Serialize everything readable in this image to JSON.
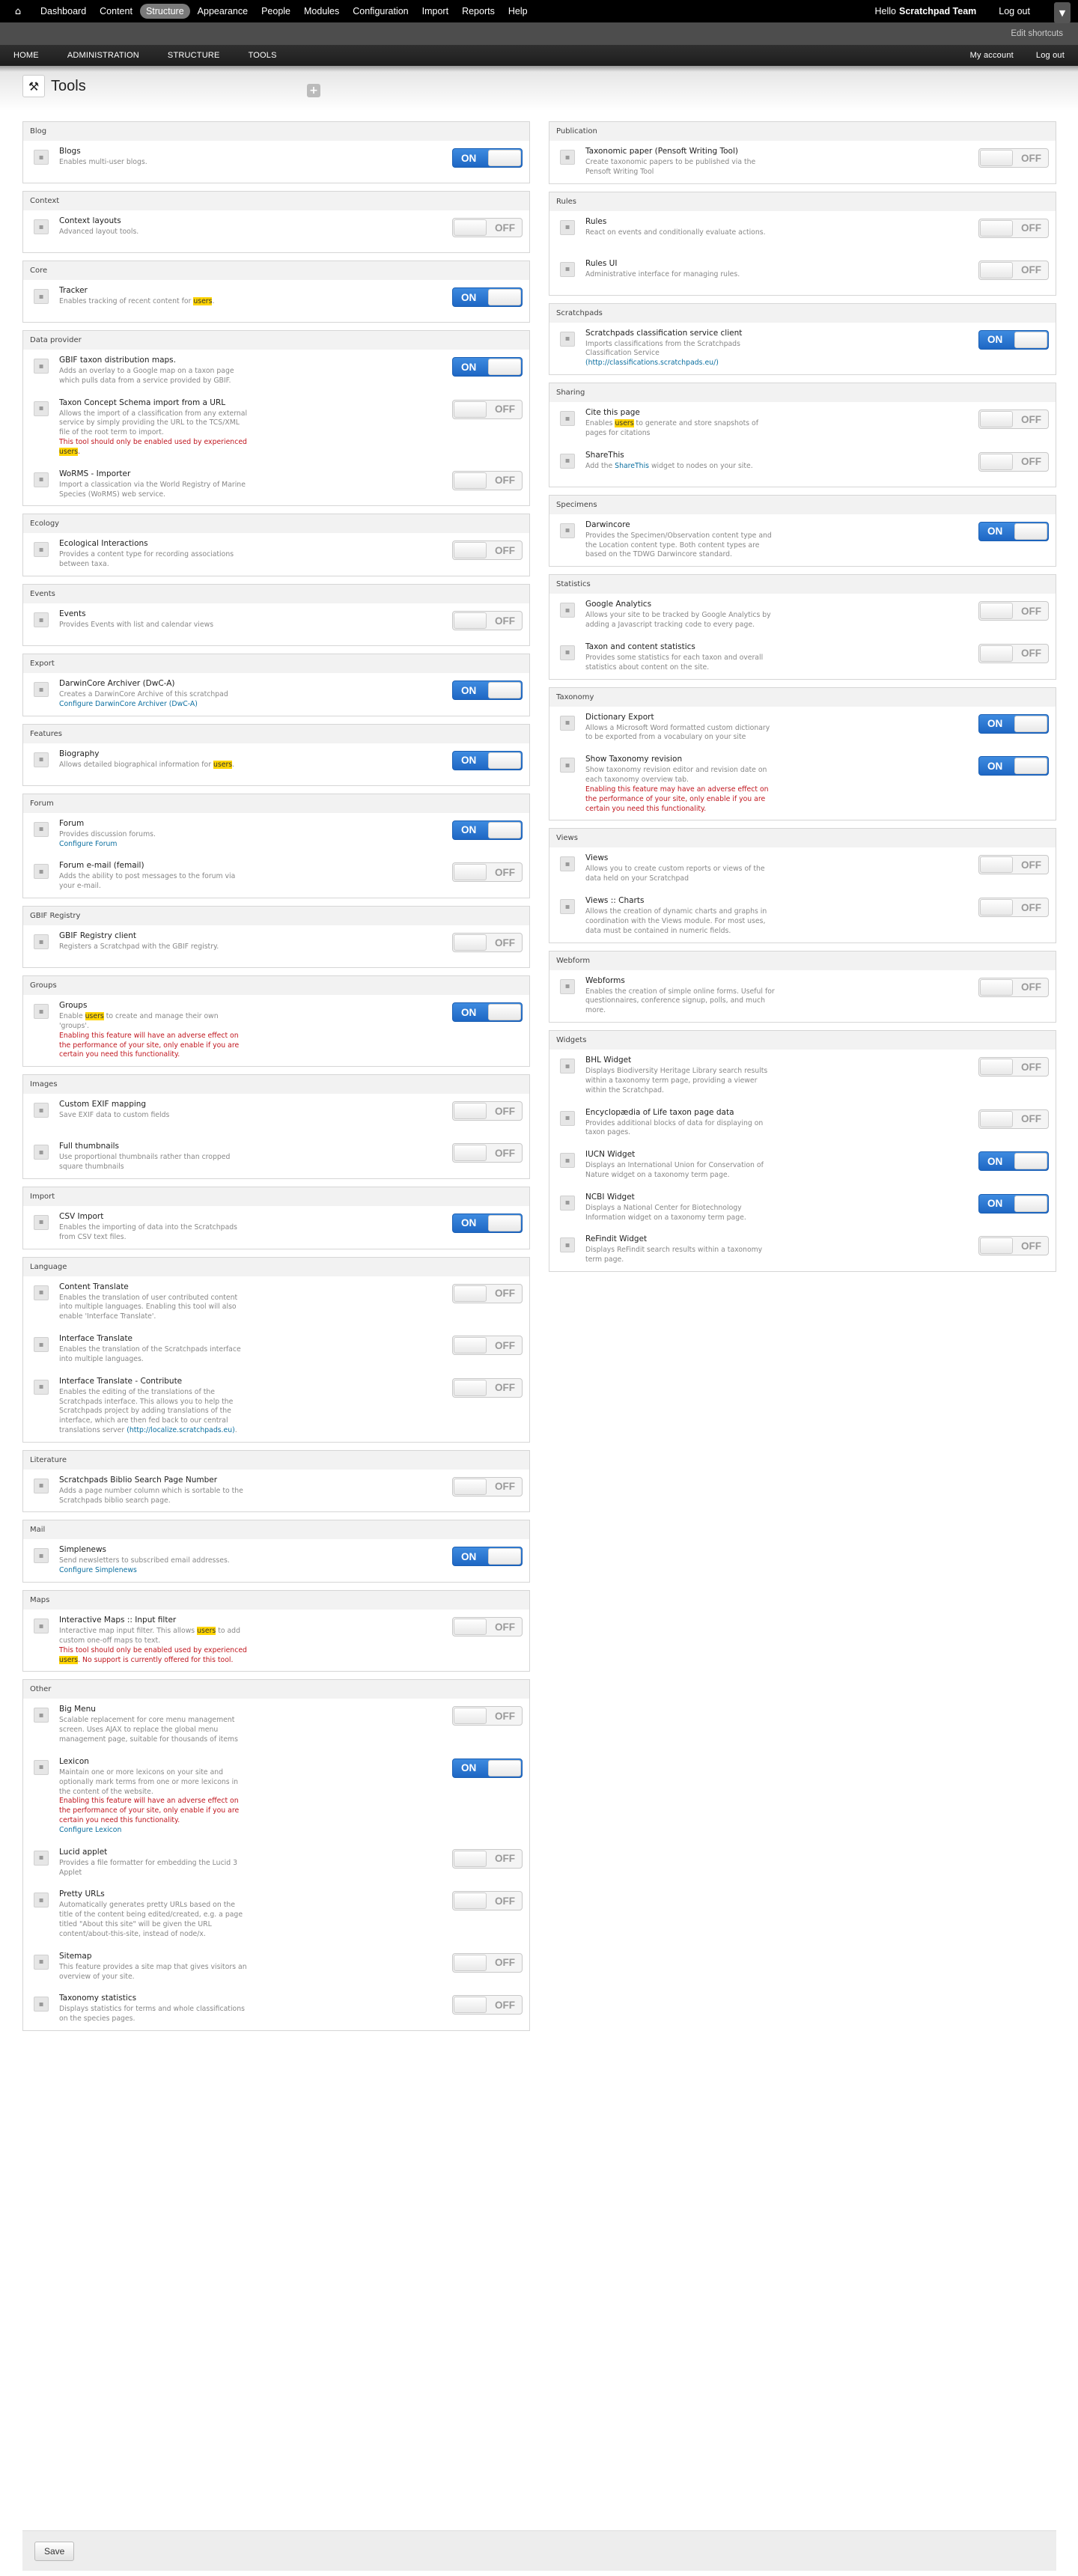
{
  "toolbar": {
    "menu": [
      "Dashboard",
      "Content",
      "Structure",
      "Appearance",
      "People",
      "Modules",
      "Configuration",
      "Import",
      "Reports",
      "Help"
    ],
    "active": "Structure",
    "hello": "Hello",
    "user": "Scratchpad Team",
    "logout": "Log out",
    "edit_shortcuts": "Edit shortcuts"
  },
  "nav": {
    "left": [
      "HOME",
      "ADMINISTRATION",
      "STRUCTURE",
      "TOOLS"
    ],
    "right": [
      "My account",
      "Log out"
    ]
  },
  "page_title": "Tools",
  "save_label": "Save",
  "left_sections": [
    {
      "title": "Blog",
      "items": [
        {
          "name": "Blogs",
          "desc": [
            {
              "t": "Enables multi-user blogs."
            }
          ],
          "on": true
        }
      ]
    },
    {
      "title": "Context",
      "items": [
        {
          "name": "Context layouts",
          "desc": [
            {
              "t": "Advanced layout tools."
            }
          ],
          "on": false
        }
      ]
    },
    {
      "title": "Core",
      "items": [
        {
          "name": "Tracker",
          "desc": [
            {
              "t": "Enables tracking of recent content for "
            },
            {
              "t": "users",
              "s": "hl"
            },
            {
              "t": "."
            }
          ],
          "on": true
        }
      ]
    },
    {
      "title": "Data provider",
      "items": [
        {
          "name": "GBIF taxon distribution maps.",
          "desc": [
            {
              "t": "Adds an overlay to a Google map on a taxon page which pulls data from a service provided by GBIF."
            }
          ],
          "on": true
        },
        {
          "name": "Taxon Concept Schema import from a URL",
          "desc": [
            {
              "t": "Allows the import of a classification from any external service by simply providing the URL to the TCS/XML file of the root term to import."
            },
            {
              "br": 1
            },
            {
              "t": "This tool should only be enabled used by experienced ",
              "s": "warn"
            },
            {
              "t": "users",
              "s": "hl"
            },
            {
              "t": ".",
              "s": "warn"
            }
          ],
          "on": false
        },
        {
          "name": "WoRMS - Importer",
          "desc": [
            {
              "t": "Import a classication via the World Registry of Marine Species (WoRMS) web service."
            }
          ],
          "on": false
        }
      ]
    },
    {
      "title": "Ecology",
      "items": [
        {
          "name": "Ecological Interactions",
          "desc": [
            {
              "t": "Provides a content type for recording associations between taxa."
            }
          ],
          "on": false
        }
      ]
    },
    {
      "title": "Events",
      "items": [
        {
          "name": "Events",
          "desc": [
            {
              "t": "Provides Events with list and calendar views"
            }
          ],
          "on": false
        }
      ]
    },
    {
      "title": "Export",
      "items": [
        {
          "name": "DarwinCore Archiver (DwC-A)",
          "desc": [
            {
              "t": "Creates a DarwinCore Archive of this scratchpad"
            },
            {
              "br": 1
            },
            {
              "t": "Configure DarwinCore Archiver (DwC-A)",
              "s": "ln"
            }
          ],
          "on": true
        }
      ]
    },
    {
      "title": "Features",
      "items": [
        {
          "name": "Biography",
          "desc": [
            {
              "t": "Allows detailed biographical information for "
            },
            {
              "t": "users",
              "s": "hl"
            },
            {
              "t": "."
            }
          ],
          "on": true
        }
      ]
    },
    {
      "title": "Forum",
      "items": [
        {
          "name": "Forum",
          "desc": [
            {
              "t": "Provides discussion forums."
            },
            {
              "br": 1
            },
            {
              "t": "Configure Forum",
              "s": "ln"
            }
          ],
          "on": true
        },
        {
          "name": "Forum e-mail (femail)",
          "desc": [
            {
              "t": "Adds the ability to post messages to the forum via your e-mail."
            }
          ],
          "on": false
        }
      ]
    },
    {
      "title": "GBIF Registry",
      "items": [
        {
          "name": "GBIF Registry client",
          "desc": [
            {
              "t": "Registers a Scratchpad with the GBIF registry."
            }
          ],
          "on": false
        }
      ]
    },
    {
      "title": "Groups",
      "items": [
        {
          "name": "Groups",
          "desc": [
            {
              "t": "Enable "
            },
            {
              "t": "users",
              "s": "hl"
            },
            {
              "t": " to create and manage their own 'groups'."
            },
            {
              "br": 1
            },
            {
              "t": "Enabling this feature will have an adverse effect on the performance of your site, only enable if you are certain you need this functionality.",
              "s": "warn"
            }
          ],
          "on": true
        }
      ]
    },
    {
      "title": "Images",
      "items": [
        {
          "name": "Custom EXIF mapping",
          "desc": [
            {
              "t": "Save EXIF data to custom fields"
            }
          ],
          "on": false
        },
        {
          "name": "Full thumbnails",
          "desc": [
            {
              "t": "Use proportional thumbnails rather than cropped square thumbnails"
            }
          ],
          "on": false
        }
      ]
    },
    {
      "title": "Import",
      "items": [
        {
          "name": "CSV Import",
          "desc": [
            {
              "t": "Enables the importing of data into the Scratchpads from CSV text files."
            }
          ],
          "on": true
        }
      ]
    },
    {
      "title": "Language",
      "items": [
        {
          "name": "Content Translate",
          "desc": [
            {
              "t": "Enables the translation of user contributed content into multiple languages. Enabling this tool will also enable 'Interface Translate'."
            }
          ],
          "on": false
        },
        {
          "name": "Interface Translate",
          "desc": [
            {
              "t": "Enables the translation of the Scratchpads interface into multiple languages."
            }
          ],
          "on": false
        },
        {
          "name": "Interface Translate - Contribute",
          "desc": [
            {
              "t": "Enables the editing of the translations of the Scratchpads interface. This allows you to help the Scratchpads project by adding translations of the interface, which are then fed back to our central translations server "
            },
            {
              "t": "(http://localize.scratchpads.eu)",
              "s": "ln"
            },
            {
              "t": "."
            }
          ],
          "on": false
        }
      ]
    },
    {
      "title": "Literature",
      "items": [
        {
          "name": "Scratchpads Biblio Search Page Number",
          "desc": [
            {
              "t": "Adds a page number column which is sortable to the Scratchpads biblio search page."
            }
          ],
          "on": false
        }
      ]
    },
    {
      "title": "Mail",
      "items": [
        {
          "name": "Simplenews",
          "desc": [
            {
              "t": "Send newsletters to subscribed email addresses."
            },
            {
              "br": 1
            },
            {
              "t": "Configure Simplenews",
              "s": "ln"
            }
          ],
          "on": true
        }
      ]
    },
    {
      "title": "Maps",
      "items": [
        {
          "name": "Interactive Maps :: Input filter",
          "desc": [
            {
              "t": "Interactive map input filter. This allows "
            },
            {
              "t": "users",
              "s": "hl"
            },
            {
              "t": " to add custom one-off maps to text."
            },
            {
              "br": 1
            },
            {
              "t": "This tool should only be enabled used by experienced ",
              "s": "warn"
            },
            {
              "t": "users",
              "s": "hl"
            },
            {
              "t": ". No support is currently offered for this tool.",
              "s": "warn"
            }
          ],
          "on": false
        }
      ]
    },
    {
      "title": "Other",
      "items": [
        {
          "name": "Big Menu",
          "desc": [
            {
              "t": "Scalable replacement for core menu management screen. Uses AJAX to replace the global menu management page, suitable for thousands of items"
            }
          ],
          "on": false
        },
        {
          "name": "Lexicon",
          "desc": [
            {
              "t": "Maintain one or more lexicons on your site and optionally mark terms from one or more lexicons in the content of the website."
            },
            {
              "br": 1
            },
            {
              "t": "Enabling this feature will have an adverse effect on the performance of your site, only enable if you are certain you need this functionality.",
              "s": "warn"
            },
            {
              "br": 1
            },
            {
              "t": "Configure Lexicon",
              "s": "ln"
            }
          ],
          "on": true
        },
        {
          "name": "Lucid applet",
          "desc": [
            {
              "t": "Provides a file formatter for embedding the Lucid 3 Applet"
            }
          ],
          "on": false
        },
        {
          "name": "Pretty URLs",
          "desc": [
            {
              "t": "Automatically generates pretty URLs based on the title of the content being edited/created, e.g. a page titled \"About this site\" will be given the URL content/about-this-site, instead of node/x."
            }
          ],
          "on": false
        },
        {
          "name": "Sitemap",
          "desc": [
            {
              "t": "This feature provides a site map that gives visitors an overview of your site."
            }
          ],
          "on": false
        },
        {
          "name": "Taxonomy statistics",
          "desc": [
            {
              "t": "Displays statistics for terms and whole classifications on the species pages."
            }
          ],
          "on": false
        }
      ]
    }
  ],
  "right_sections": [
    {
      "title": "Publication",
      "items": [
        {
          "name": "Taxonomic paper (Pensoft Writing Tool)",
          "desc": [
            {
              "t": "Create taxonomic papers to be published via the Pensoft Writing Tool"
            }
          ],
          "on": false
        }
      ]
    },
    {
      "title": "Rules",
      "items": [
        {
          "name": "Rules",
          "desc": [
            {
              "t": "React on events and conditionally evaluate actions."
            }
          ],
          "on": false
        },
        {
          "name": "Rules UI",
          "desc": [
            {
              "t": "Administrative interface for managing rules."
            }
          ],
          "on": false
        }
      ]
    },
    {
      "title": "Scratchpads",
      "items": [
        {
          "name": "Scratchpads classification service client",
          "desc": [
            {
              "t": "Imports classifications from the Scratchpads Classification Service "
            },
            {
              "t": "(http://classifications.scratchpads.eu/)",
              "s": "ln"
            }
          ],
          "on": true
        }
      ]
    },
    {
      "title": "Sharing",
      "items": [
        {
          "name": "Cite this page",
          "desc": [
            {
              "t": "Enables "
            },
            {
              "t": "users",
              "s": "hl"
            },
            {
              "t": " to generate and store snapshots of pages for citations"
            }
          ],
          "on": false
        },
        {
          "name": "ShareThis",
          "desc": [
            {
              "t": "Add the "
            },
            {
              "t": "ShareThis",
              "s": "ln"
            },
            {
              "t": " widget to nodes on your site."
            }
          ],
          "on": false
        }
      ]
    },
    {
      "title": "Specimens",
      "items": [
        {
          "name": "Darwincore",
          "desc": [
            {
              "t": "Provides the Specimen/Observation content type and the Location content type. Both content types are based on the TDWG Darwincore standard."
            }
          ],
          "on": true
        }
      ]
    },
    {
      "title": "Statistics",
      "items": [
        {
          "name": "Google Analytics",
          "desc": [
            {
              "t": "Allows your site to be tracked by Google Analytics by adding a Javascript tracking code to every page."
            }
          ],
          "on": false
        },
        {
          "name": "Taxon and content statistics",
          "desc": [
            {
              "t": "Provides some statistics for each taxon and overall statistics about content on the site."
            }
          ],
          "on": false
        }
      ]
    },
    {
      "title": "Taxonomy",
      "items": [
        {
          "name": "Dictionary Export",
          "desc": [
            {
              "t": "Allows a Microsoft Word formatted custom dictionary to be exported from a vocabulary on your site"
            }
          ],
          "on": true
        },
        {
          "name": "Show Taxonomy revision",
          "desc": [
            {
              "t": "Show taxonomy revision editor and revision date on each taxonomy overview tab."
            },
            {
              "br": 1
            },
            {
              "t": "Enabling this feature may have an adverse effect on the performance of your site, only enable if you are certain you need this functionality.",
              "s": "warn"
            }
          ],
          "on": true
        }
      ]
    },
    {
      "title": "Views",
      "items": [
        {
          "name": "Views",
          "desc": [
            {
              "t": "Allows you to create custom reports or views of the data held on your Scratchpad"
            }
          ],
          "on": false
        },
        {
          "name": "Views :: Charts",
          "desc": [
            {
              "t": "Allows the creation of dynamic charts and graphs in coordination with the Views module. For most uses, data must be contained in numeric fields."
            }
          ],
          "on": false
        }
      ]
    },
    {
      "title": "Webform",
      "items": [
        {
          "name": "Webforms",
          "desc": [
            {
              "t": "Enables the creation of simple online forms. Useful for questionnaires, conference signup, polls, and much more."
            }
          ],
          "on": false
        }
      ]
    },
    {
      "title": "Widgets",
      "items": [
        {
          "name": "BHL Widget",
          "desc": [
            {
              "t": "Displays Biodiversity Heritage Library search results within a taxonomy term page, providing a viewer within the Scratchpad."
            }
          ],
          "on": false
        },
        {
          "name": "Encyclopædia of Life taxon page data",
          "desc": [
            {
              "t": "Provides additional blocks of data for displaying on taxon pages."
            }
          ],
          "on": false
        },
        {
          "name": "IUCN Widget",
          "desc": [
            {
              "t": "Displays an International Union for Conservation of Nature widget on a taxonomy term page."
            }
          ],
          "on": true
        },
        {
          "name": "NCBI Widget",
          "desc": [
            {
              "t": "Displays a National Center for Biotechnology Information widget on a taxonomy term page."
            }
          ],
          "on": true
        },
        {
          "name": "ReFindit Widget",
          "desc": [
            {
              "t": "Displays ReFindit search results within a taxonomy term page."
            }
          ],
          "on": false
        }
      ]
    }
  ],
  "switch_labels": {
    "on": "ON",
    "off": "OFF"
  }
}
